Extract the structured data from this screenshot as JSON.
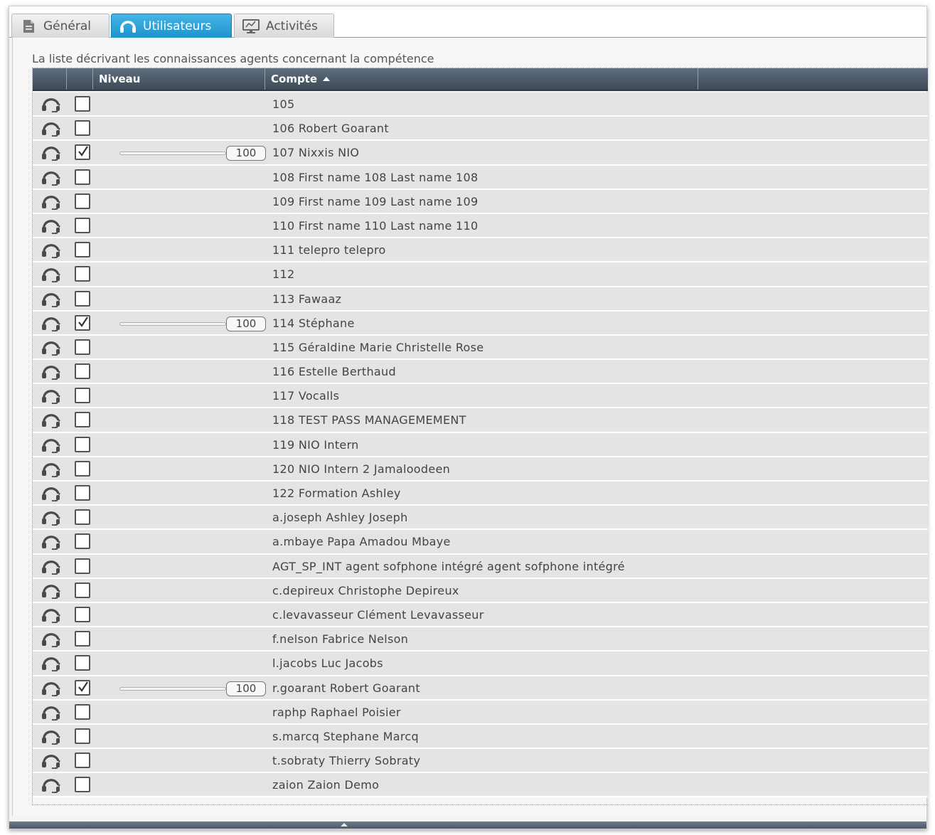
{
  "tabs": [
    {
      "label": "Général",
      "icon": "document-icon",
      "active": false
    },
    {
      "label": "Utilisateurs",
      "icon": "headset-icon",
      "active": true
    },
    {
      "label": "Activités",
      "icon": "monitor-icon",
      "active": false
    }
  ],
  "caption": "La liste décrivant les connaissances agents concernant la compétence",
  "columns": {
    "level": "Niveau",
    "account": "Compte",
    "sort_direction": "ascending"
  },
  "colors": {
    "active_tab": "#2aa3dc",
    "header": "#4a5664",
    "row": "#e4e4e4"
  },
  "rows": [
    {
      "account": "105",
      "checked": false,
      "level": ""
    },
    {
      "account": "106 Robert Goarant",
      "checked": false,
      "level": ""
    },
    {
      "account": "107 Nixxis NIO",
      "checked": true,
      "level": "100"
    },
    {
      "account": "108 First name 108 Last name 108",
      "checked": false,
      "level": ""
    },
    {
      "account": "109 First name 109 Last name 109",
      "checked": false,
      "level": ""
    },
    {
      "account": "110 First name 110 Last name 110",
      "checked": false,
      "level": ""
    },
    {
      "account": "111 telepro telepro",
      "checked": false,
      "level": ""
    },
    {
      "account": "112",
      "checked": false,
      "level": ""
    },
    {
      "account": "113 Fawaaz",
      "checked": false,
      "level": ""
    },
    {
      "account": "114 Stéphane",
      "checked": true,
      "level": "100"
    },
    {
      "account": "115 Géraldine Marie Christelle Rose",
      "checked": false,
      "level": ""
    },
    {
      "account": "116 Estelle Berthaud",
      "checked": false,
      "level": ""
    },
    {
      "account": "117 Vocalls",
      "checked": false,
      "level": ""
    },
    {
      "account": "118 TEST PASS MANAGEMEMENT",
      "checked": false,
      "level": ""
    },
    {
      "account": "119 NIO Intern",
      "checked": false,
      "level": ""
    },
    {
      "account": "120 NIO Intern 2 Jamaloodeen",
      "checked": false,
      "level": ""
    },
    {
      "account": "122 Formation Ashley",
      "checked": false,
      "level": ""
    },
    {
      "account": "a.joseph Ashley Joseph",
      "checked": false,
      "level": ""
    },
    {
      "account": "a.mbaye Papa Amadou Mbaye",
      "checked": false,
      "level": ""
    },
    {
      "account": "AGT_SP_INT agent sofphone intégré agent sofphone intégré",
      "checked": false,
      "level": ""
    },
    {
      "account": "c.depireux Christophe Depireux",
      "checked": false,
      "level": ""
    },
    {
      "account": "c.levavasseur Clément Levavasseur",
      "checked": false,
      "level": ""
    },
    {
      "account": "f.nelson Fabrice Nelson",
      "checked": false,
      "level": ""
    },
    {
      "account": "l.jacobs Luc Jacobs",
      "checked": false,
      "level": ""
    },
    {
      "account": "r.goarant Robert Goarant",
      "checked": true,
      "level": "100"
    },
    {
      "account": "raphp Raphael Poisier",
      "checked": false,
      "level": ""
    },
    {
      "account": "s.marcq Stephane Marcq",
      "checked": false,
      "level": ""
    },
    {
      "account": "t.sobraty Thierry Sobraty",
      "checked": false,
      "level": ""
    },
    {
      "account": "zaion Zaion Demo",
      "checked": false,
      "level": ""
    }
  ]
}
